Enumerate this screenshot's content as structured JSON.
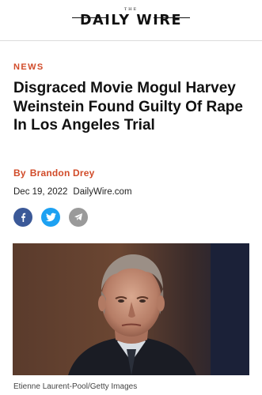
{
  "header": {
    "logo_small": "THE",
    "logo_main": "DAILY WIRE"
  },
  "article": {
    "category": "NEWS",
    "headline": "Disgraced Movie Mogul Harvey Weinstein Found Guilty Of Rape In Los Angeles Trial",
    "byline_prefix": "By",
    "author": "Brandon Drey",
    "date": "Dec 19, 2022",
    "site": "DailyWire.com",
    "image_caption": "Etienne Laurent-Pool/Getty Images"
  },
  "share": [
    {
      "icon": "facebook-icon",
      "color": "#3b5998"
    },
    {
      "icon": "twitter-icon",
      "color": "#1da1f2"
    },
    {
      "icon": "telegram-icon",
      "color": "#9a9a9a"
    }
  ],
  "colors": {
    "accent": "#d14b29",
    "text": "#111111"
  }
}
